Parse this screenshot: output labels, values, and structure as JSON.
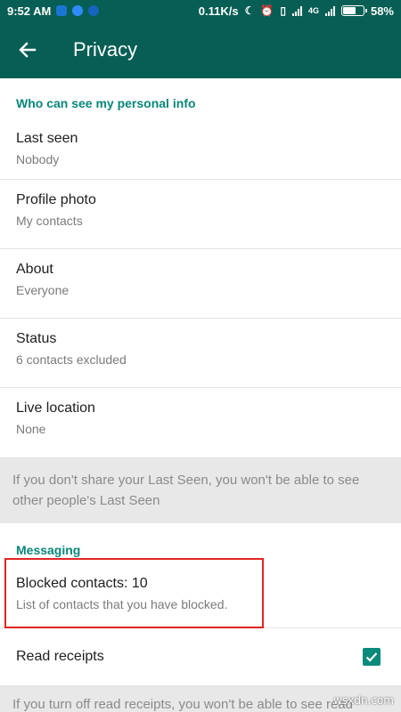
{
  "status_bar": {
    "time": "9:52 AM",
    "network_speed": "0.11K/s",
    "network_type": "4G",
    "battery_text": "58%",
    "battery_level": 0.58,
    "icons": [
      "app-icon",
      "app-icon",
      "upload-icon",
      "moon-icon",
      "alarm-icon",
      "vibrate-icon",
      "signal-icon",
      "battery-icon"
    ]
  },
  "app_bar": {
    "back_icon": "arrow-back-icon",
    "title": "Privacy"
  },
  "personal_info": {
    "header": "Who can see my personal info",
    "items": [
      {
        "label": "Last seen",
        "value": "Nobody"
      },
      {
        "label": "Profile photo",
        "value": "My contacts"
      },
      {
        "label": "About",
        "value": "Everyone"
      },
      {
        "label": "Status",
        "value": "6 contacts excluded"
      },
      {
        "label": "Live location",
        "value": "None"
      }
    ],
    "note": "If you don't share your Last Seen, you won't be able to see other people's Last Seen"
  },
  "messaging": {
    "header": "Messaging",
    "blocked": {
      "label": "Blocked contacts: 10",
      "description": "List of contacts that you have blocked."
    },
    "read_receipts": {
      "label": "Read receipts",
      "checked": true
    },
    "note": "If you turn off read receipts, you won't be able to see read"
  },
  "colors": {
    "toolbar": "#075e54",
    "accent": "#08877a",
    "highlight_box": "#e02424"
  },
  "watermark": "wsxdn.com"
}
